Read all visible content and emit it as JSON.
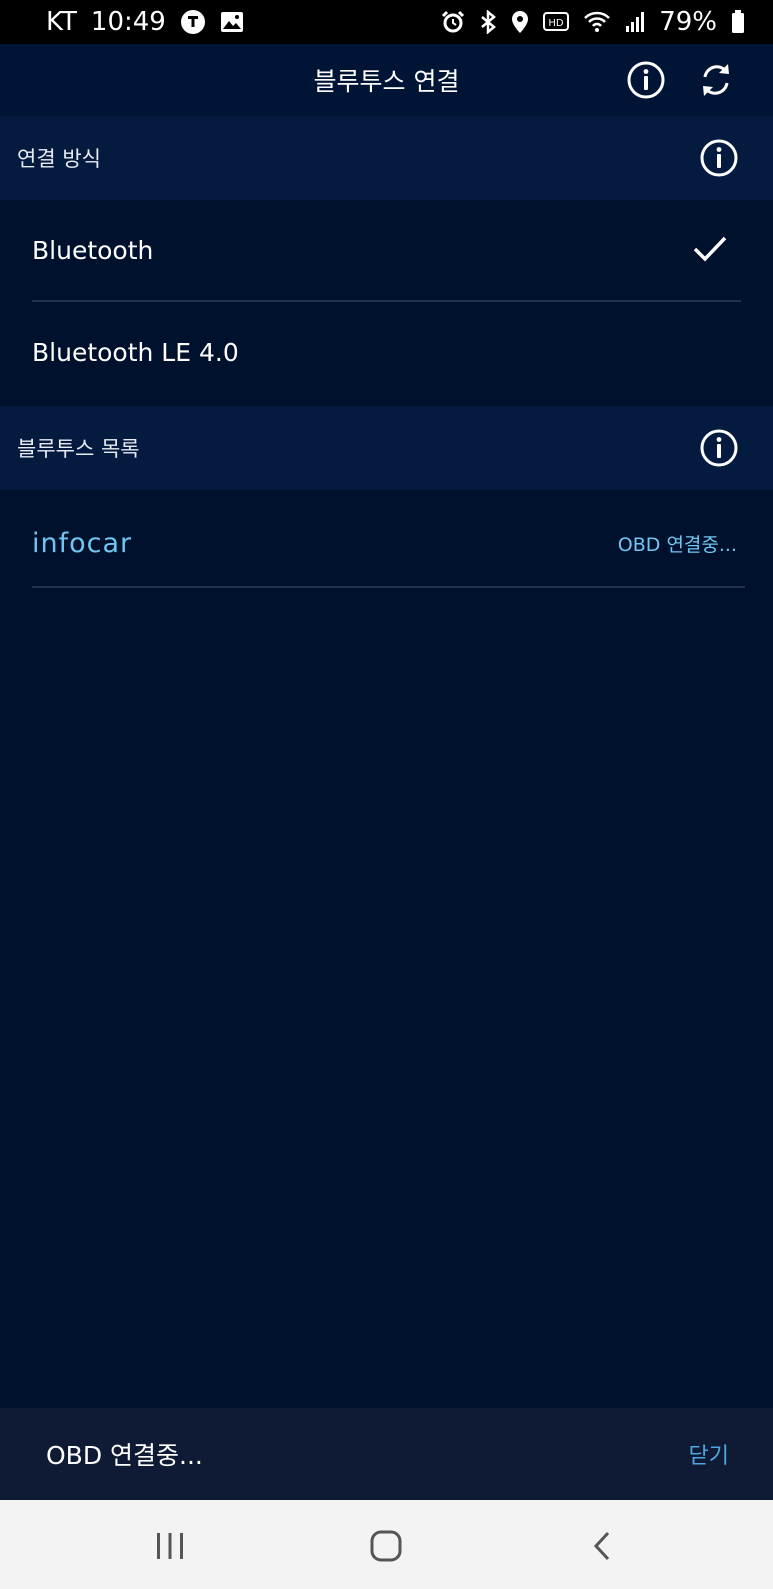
{
  "status_bar": {
    "carrier": "KT",
    "time": "10:49",
    "battery": "79%",
    "left_icons": [
      "talk-icon",
      "image-icon"
    ],
    "right_icons": [
      "alarm-icon",
      "bluetooth-icon",
      "location-icon",
      "hd-icon",
      "wifi-icon",
      "signal-icon",
      "battery-icon"
    ]
  },
  "header": {
    "title": "블루투스 연결",
    "icons": [
      "info-icon",
      "refresh-icon"
    ]
  },
  "connection_method": {
    "title": "연결 방식",
    "options": [
      {
        "label": "Bluetooth",
        "selected": true
      },
      {
        "label": "Bluetooth LE 4.0",
        "selected": false
      }
    ]
  },
  "device_list": {
    "title": "블루투스 목록",
    "devices": [
      {
        "name": "infocar",
        "status": "OBD 연결중..."
      }
    ]
  },
  "toast": {
    "message": "OBD 연결중...",
    "close_label": "닫기"
  },
  "colors": {
    "background": "#00112e",
    "section_header": "#041a3e",
    "accent": "#6fc6f0",
    "toast_bg": "#0f1b34",
    "toast_action": "#4fa6e0"
  },
  "nav_bar": {
    "buttons": [
      "recent-apps-icon",
      "home-icon",
      "back-icon"
    ]
  }
}
